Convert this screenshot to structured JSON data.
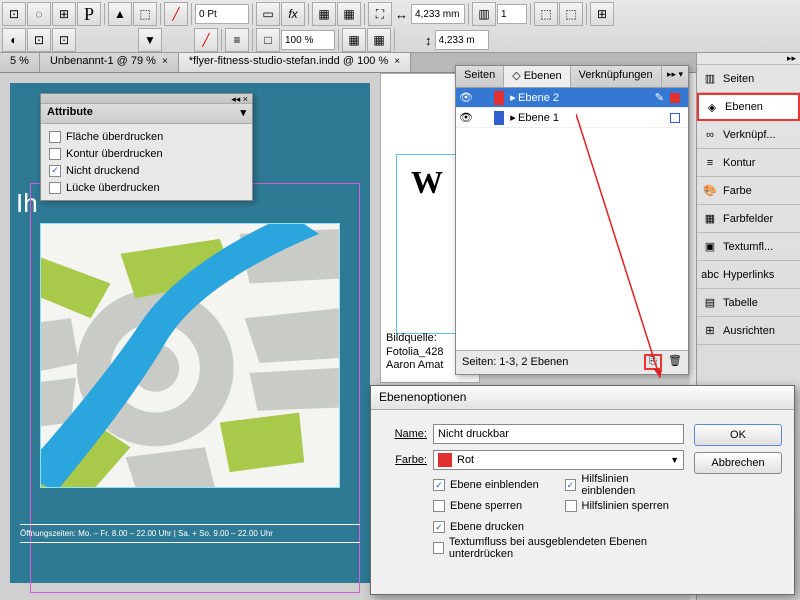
{
  "toolbar": {
    "pt_value": "0 Pt",
    "zoom_value": "100 %",
    "w_value": "4,233 mm",
    "h_value": "4,233 m",
    "count_value": "1"
  },
  "tabs": [
    {
      "label": "5 %"
    },
    {
      "label": "Unbenannt-1 @ 79 %"
    },
    {
      "label": "*flyer-fitness-studio-stefan.indd @ 100 %"
    }
  ],
  "canvas": {
    "heading": "Ih",
    "footer": "Öffnungszeiten: Mo. – Fr. 8.00 – 22.00 Uhr | Sa. + So. 9.00 – 22.00 Uhr"
  },
  "doc2": {
    "bigletter": "W",
    "caption1": "Bildquelle:",
    "caption2": "Fotolia_428",
    "caption3": "Aaron Amat"
  },
  "rightstrip": [
    {
      "label": "Seiten",
      "icon": "pages-icon"
    },
    {
      "label": "Ebenen",
      "icon": "layers-icon",
      "selected": true
    },
    {
      "label": "Verknüpf...",
      "icon": "links-icon"
    },
    {
      "label": "Kontur",
      "icon": "stroke-icon"
    },
    {
      "label": "Farbe",
      "icon": "color-icon"
    },
    {
      "label": "Farbfelder",
      "icon": "swatches-icon"
    },
    {
      "label": "Textumfl...",
      "icon": "textwrap-icon"
    },
    {
      "label": "Hyperlinks",
      "icon": "hyperlinks-icon"
    },
    {
      "label": "Tabelle",
      "icon": "table-icon"
    },
    {
      "label": "Ausrichten",
      "icon": "align-icon"
    }
  ],
  "layers_panel": {
    "tabs": [
      "Seiten",
      "Ebenen",
      "Verknüpfungen"
    ],
    "active_tab": 1,
    "layers": [
      {
        "name": "Ebene 2",
        "color": "#e03030",
        "selected": true,
        "pen": true
      },
      {
        "name": "Ebene 1",
        "color": "#3060d0",
        "selected": false,
        "pen": false
      }
    ],
    "status": "Seiten: 1-3, 2 Ebenen"
  },
  "attributes_panel": {
    "title": "Attribute",
    "items": [
      {
        "label": "Fläche überdrucken",
        "checked": false
      },
      {
        "label": "Kontur überdrucken",
        "checked": false
      },
      {
        "label": "Nicht druckend",
        "checked": true
      },
      {
        "label": "Lücke überdrucken",
        "checked": false
      }
    ]
  },
  "dialog": {
    "title": "Ebenenoptionen",
    "name_label": "Name:",
    "name_value": "Nicht druckbar",
    "color_label": "Farbe:",
    "color_name": "Rot",
    "color_hex": "#e03030",
    "ok": "OK",
    "cancel": "Abbrechen",
    "checks": [
      {
        "label": "Ebene einblenden",
        "checked": true
      },
      {
        "label": "Hilfslinien einblenden",
        "checked": true
      },
      {
        "label": "Ebene sperren",
        "checked": false
      },
      {
        "label": "Hilfslinien sperren",
        "checked": false
      },
      {
        "label": "Ebene drucken",
        "checked": true
      },
      {
        "label": "Textumfluss bei ausgeblendeten Ebenen unterdrücken",
        "checked": false,
        "full": true
      }
    ]
  }
}
